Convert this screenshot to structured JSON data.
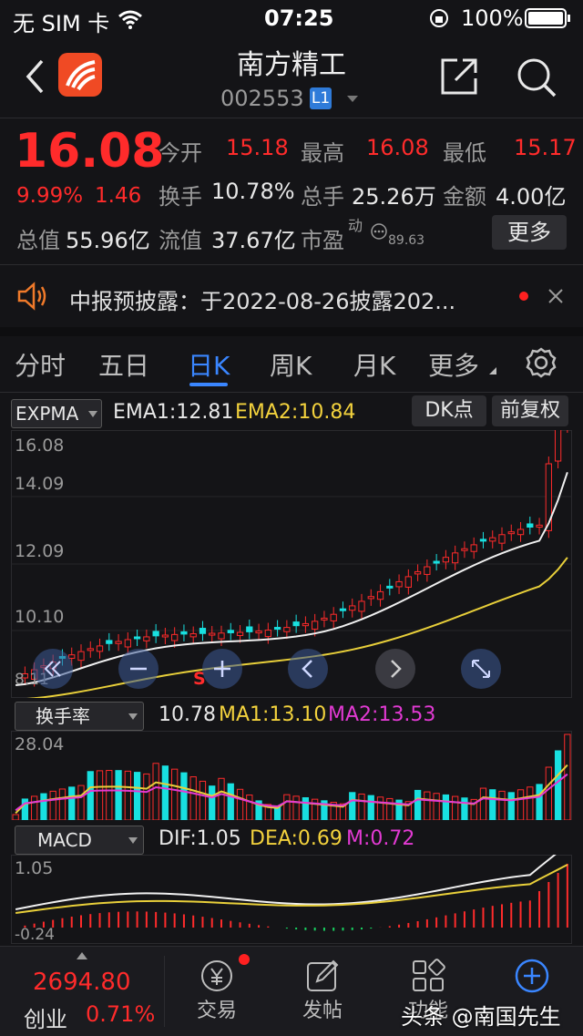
{
  "status_bar": {
    "carrier": "无 SIM 卡",
    "time": "07:25",
    "battery": "100%"
  },
  "header": {
    "title": "南方精工",
    "code": "002553",
    "badge": "L1"
  },
  "quote": {
    "price": "16.08",
    "change_pct": "9.99%",
    "change": "1.46",
    "open_label": "今开",
    "open": "15.18",
    "high_label": "最高",
    "high": "16.08",
    "low_label": "最低",
    "low": "15.17",
    "turnover_label": "换手",
    "turnover": "10.78%",
    "volume_label": "总手",
    "volume": "25.26万",
    "amount_label": "金额",
    "amount": "4.00亿",
    "mktcap_label": "总值",
    "mktcap": "55.96亿",
    "float_label": "流值",
    "float": "37.67亿",
    "pe_label": "市盈",
    "pe_sup": "动",
    "pe": "89.63",
    "more_button": "更多"
  },
  "notice": {
    "text": "中报预披露：于2022-08-26披露202..."
  },
  "tabs": [
    "分时",
    "五日",
    "日K",
    "周K",
    "月K",
    "更多"
  ],
  "active_tab": "日K",
  "kline": {
    "indicator": "EXPMA",
    "ema1": "EMA1:12.81",
    "ema2": "EMA2:10.84",
    "dk_button": "DK点",
    "fq_button": "前复权",
    "y_labels": [
      "16.08",
      "14.09",
      "12.09",
      "10.10",
      "8.11"
    ],
    "s_mark": "S"
  },
  "turnover_panel": {
    "indicator": "换手率",
    "value": "10.78",
    "ma1": "MA1:13.10",
    "ma2": "MA2:13.53",
    "y_top": "28.04"
  },
  "macd_panel": {
    "indicator": "MACD",
    "dif": "DIF:1.05",
    "dea": "DEA:0.69",
    "m": "M:0.72",
    "y_top": "1.05",
    "y_bottom": "-0.24"
  },
  "bottom_bar": {
    "index_value": "2694.80",
    "index_name": "创业",
    "index_change": "0.71%",
    "items": [
      "交易",
      "发帖",
      "功能"
    ]
  },
  "watermark": "头条 @南国先生",
  "colors": {
    "up": "#ff2b2b",
    "down": "#18e0e0",
    "accent": "#3a86ff"
  }
}
